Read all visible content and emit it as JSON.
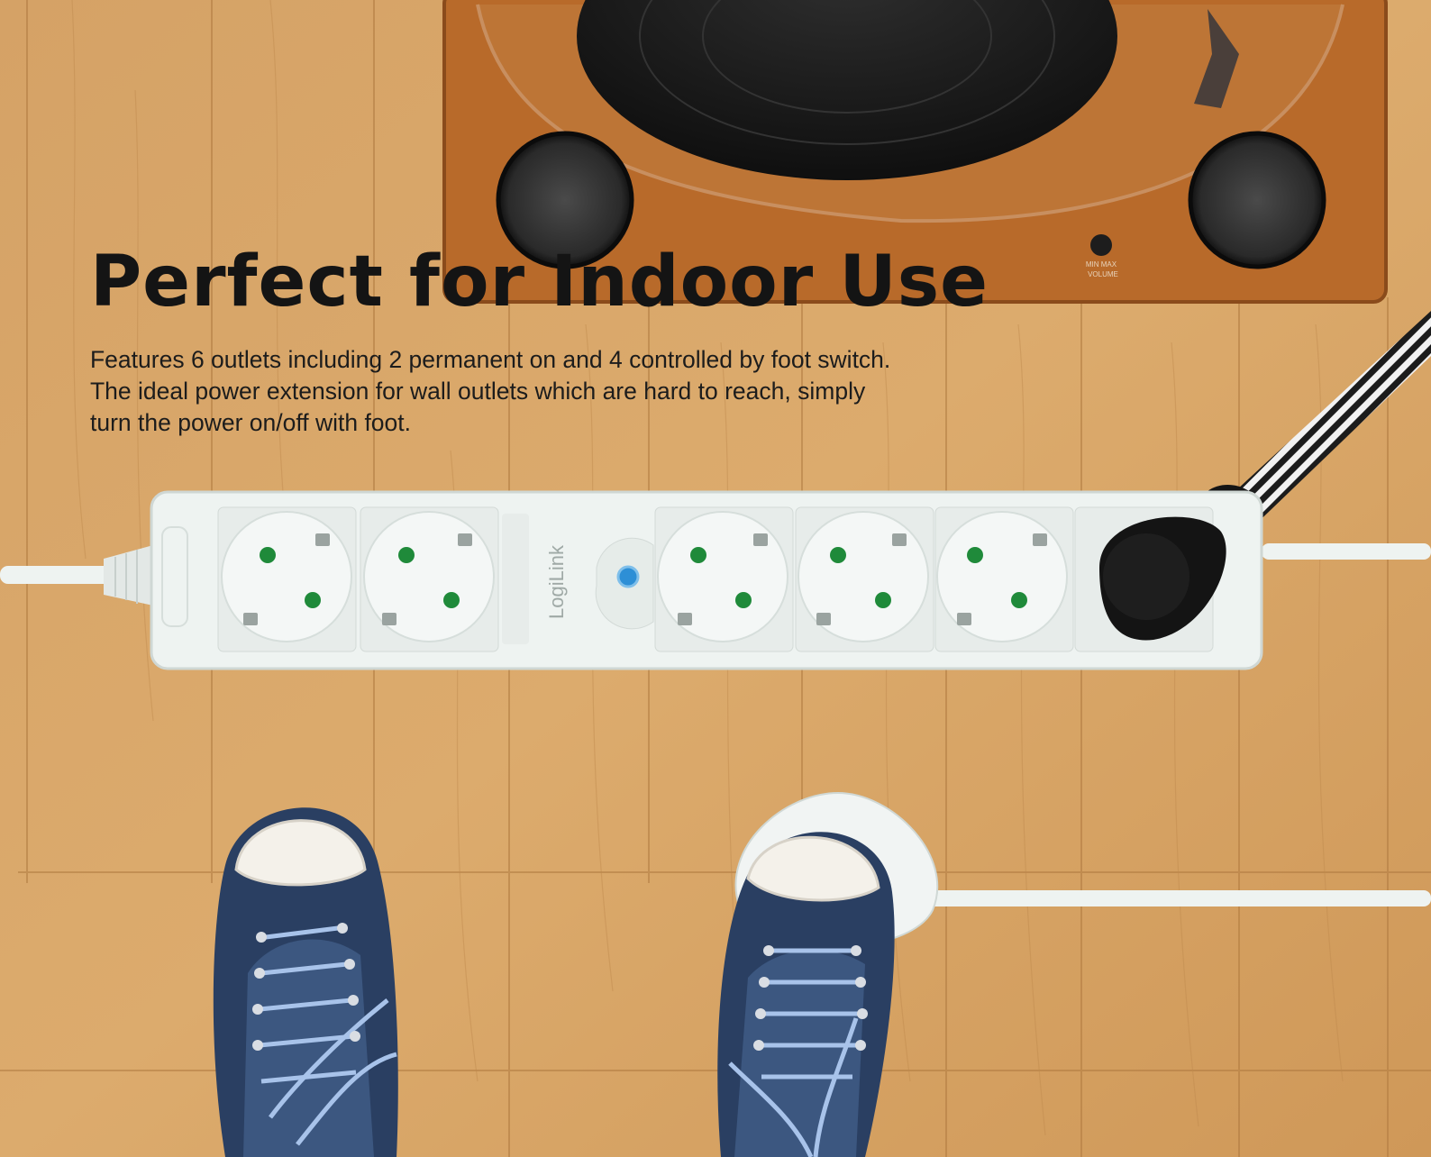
{
  "headline": "Perfect for Indoor Use",
  "body": "Features 6 outlets including 2 permanent on and 4 controlled by foot switch. The ideal power extension for wall outlets which are hard to reach, simply turn the power on/off with foot.",
  "brand_label": "LogiLink",
  "volume_label": "MIN   MAX",
  "volume_caption": "VOLUME",
  "colors": {
    "floor": "#d9a465",
    "turntable_wood": "#b86a2a",
    "power_strip": "#eef3f1",
    "socket_contact_green": "#1f8a3a",
    "sneaker_denim": "#2a3f62",
    "headline_text": "#141414"
  }
}
